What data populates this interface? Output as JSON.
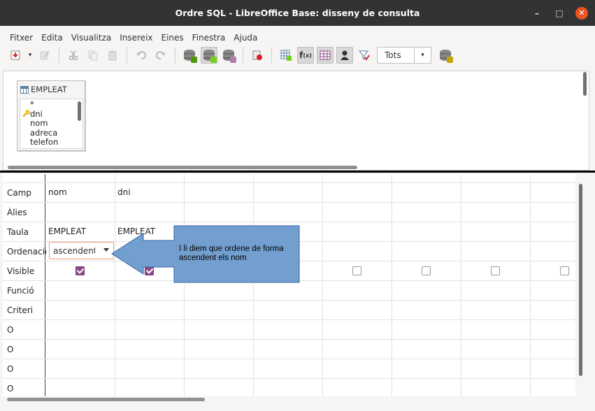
{
  "window": {
    "title": "Ordre SQL - LibreOffice Base: disseny de consulta",
    "minimize": "–",
    "maximize": "□",
    "close": "✕"
  },
  "menu": [
    "Fitxer",
    "Edita",
    "Visualitza",
    "Insereix",
    "Eines",
    "Finestra",
    "Ajuda"
  ],
  "toolbar": {
    "distinct_value": "Tots",
    "dropdown_arrow": "▾"
  },
  "table_window": {
    "table_name": "EMPLEAT",
    "fields": [
      "*",
      "dni",
      "nom",
      "adreca",
      "telefon"
    ],
    "primary_key_field": "dni"
  },
  "grid": {
    "row_labels": [
      "Camp",
      "Àlies",
      "Taula",
      "Ordenació",
      "Visible",
      "Funció",
      "Criteri",
      "O",
      "O",
      "O",
      "O"
    ],
    "columns": [
      {
        "field": "nom",
        "table": "EMPLEAT",
        "sort": "ascendent",
        "visible": true
      },
      {
        "field": "dni",
        "table": "EMPLEAT",
        "sort": "",
        "visible": true
      },
      {
        "field": "",
        "table": "",
        "sort": "",
        "visible": false
      },
      {
        "field": "",
        "table": "",
        "sort": "",
        "visible": false
      },
      {
        "field": "",
        "table": "",
        "sort": "",
        "visible": false
      },
      {
        "field": "",
        "table": "",
        "sort": "",
        "visible": false
      },
      {
        "field": "",
        "table": "",
        "sort": "",
        "visible": false
      },
      {
        "field": "",
        "table": "",
        "sort": "",
        "visible": false
      }
    ]
  },
  "callout": {
    "text": "I li diem que ordene de forma ascendent els nom",
    "fill_color": "#729fcf",
    "border_color": "#3465a4"
  }
}
